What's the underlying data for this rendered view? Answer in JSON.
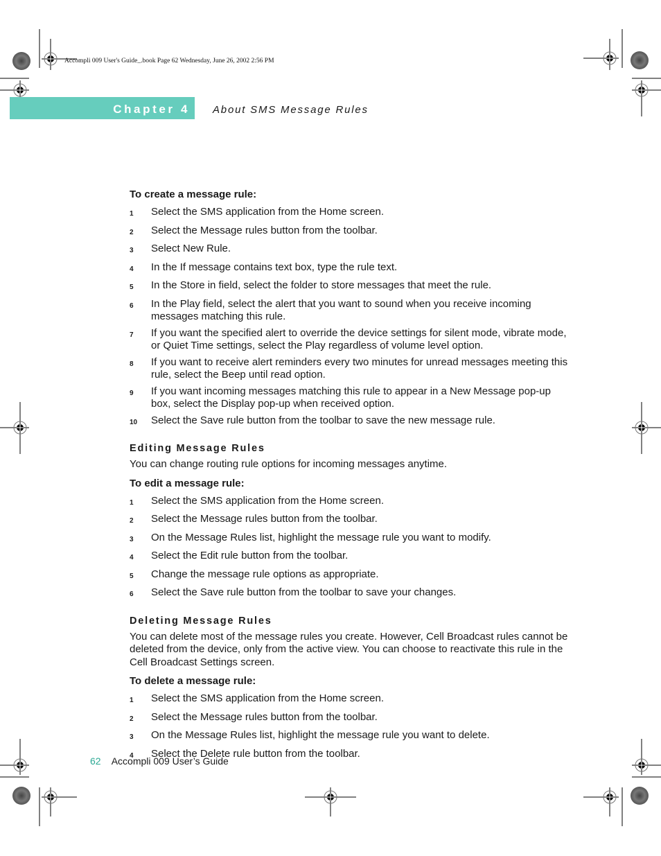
{
  "print_header": "Accompli 009 User's Guide_.book  Page 62  Wednesday, June 26, 2002  2:56 PM",
  "chapter": {
    "label": "Chapter 4",
    "title": "About SMS Message Rules",
    "band_color": "#66cdbd"
  },
  "create_procedure": {
    "title": "To create a message rule:",
    "steps": [
      {
        "num": "1",
        "text": "Select the SMS application from the Home screen."
      },
      {
        "num": "2",
        "text": "Select the Message rules button from the toolbar."
      },
      {
        "num": "3",
        "text": "Select New Rule."
      },
      {
        "num": "4",
        "text": "In the If message contains text box, type the rule text."
      },
      {
        "num": "5",
        "text": "In the Store in field, select the folder to store messages that meet the rule."
      },
      {
        "num": "6",
        "text": "In the Play field, select the alert that you want to sound when you receive incoming messages matching this rule."
      },
      {
        "num": "7",
        "text": "If you want the specified alert to override the device settings for silent mode, vibrate mode, or Quiet Time settings, select the Play regardless of volume level option."
      },
      {
        "num": "8",
        "text": "If you want to receive alert reminders every two minutes for unread messages meeting this rule, select the Beep until read option."
      },
      {
        "num": "9",
        "text": "If you want incoming messages matching this rule to appear in a New Message pop-up box, select the Display pop-up when received option."
      },
      {
        "num": "10",
        "text": "Select the Save rule button from the toolbar to save the new message rule."
      }
    ]
  },
  "editing_section": {
    "heading": "Editing Message Rules",
    "intro": "You can change routing rule options for incoming messages anytime.",
    "procedure_title": "To edit a message rule:",
    "steps": [
      {
        "num": "1",
        "text": "Select the SMS application from the Home screen."
      },
      {
        "num": "2",
        "text": "Select the Message rules button from the toolbar."
      },
      {
        "num": "3",
        "text": "On the Message Rules list, highlight the message rule you want to modify."
      },
      {
        "num": "4",
        "text": "Select the Edit rule button from the toolbar."
      },
      {
        "num": "5",
        "text": "Change the message rule options as appropriate."
      },
      {
        "num": "6",
        "text": "Select the Save rule button from the toolbar to save your changes."
      }
    ]
  },
  "deleting_section": {
    "heading": "Deleting Message Rules",
    "intro": "You can delete most of the message rules you create. However, Cell Broadcast rules cannot be deleted from the device, only from the active view. You can choose to reactivate this rule in the Cell Broadcast Settings screen.",
    "procedure_title": "To delete a message rule:",
    "steps": [
      {
        "num": "1",
        "text": "Select the SMS application from the Home screen."
      },
      {
        "num": "2",
        "text": "Select the Message rules button from the toolbar."
      },
      {
        "num": "3",
        "text": "On the Message Rules list, highlight the message rule you want to delete."
      },
      {
        "num": "4",
        "text": "Select the Delete rule button from the toolbar."
      }
    ]
  },
  "footer": {
    "page_number": "62",
    "book_title": "Accompli 009 User’s Guide",
    "page_number_color": "#2aa893"
  }
}
